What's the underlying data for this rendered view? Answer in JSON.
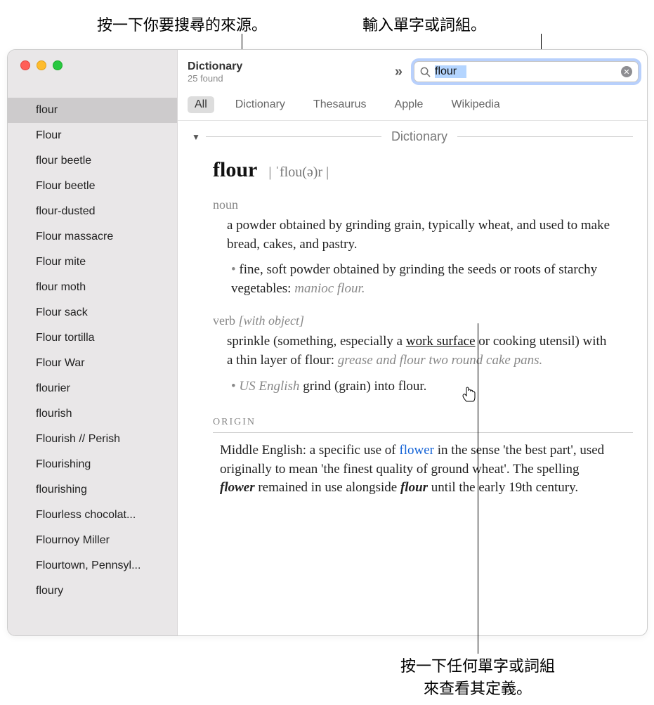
{
  "callouts": {
    "top_left": "按一下你要搜尋的來源。",
    "top_right": "輸入單字或詞組。",
    "bottom_line1": "按一下任何單字或詞組",
    "bottom_line2": "來查看其定義。"
  },
  "window": {
    "title": "Dictionary",
    "subtitle": "25 found"
  },
  "search": {
    "value": "flour"
  },
  "source_tabs": [
    "All",
    "Dictionary",
    "Thesaurus",
    "Apple",
    "Wikipedia"
  ],
  "active_source": "All",
  "sidebar": {
    "selected_index": 0,
    "items": [
      "flour",
      "Flour",
      "flour beetle",
      "Flour beetle",
      "flour-dusted",
      "Flour massacre",
      "Flour mite",
      "flour moth",
      "Flour sack",
      "Flour tortilla",
      "Flour War",
      "flourier",
      "flourish",
      "Flourish // Perish",
      "Flourishing",
      "flourishing",
      "Flourless chocolat...",
      "Flournoy Miller",
      "Flourtown, Pennsyl...",
      "floury"
    ]
  },
  "entry": {
    "section_label": "Dictionary",
    "headword": "flour",
    "pronunciation": "| ˈflou(ə)r |",
    "noun_label": "noun",
    "noun_def": "a powder obtained by grinding grain, typically wheat, and used to make bread, cakes, and pastry.",
    "noun_sub_def_pre": "fine, soft powder obtained by grinding the seeds or roots of starchy vegetables: ",
    "noun_sub_example": "manioc flour.",
    "verb_label": "verb",
    "verb_gram": "[with object]",
    "verb_def_pre": "sprinkle (something, especially a ",
    "verb_def_link": "work surface",
    "verb_def_post": " or cooking utensil) with a thin layer of flour: ",
    "verb_example": "grease and flour two round cake pans.",
    "verb_sub_region": "US English",
    "verb_sub_def": " grind (grain) into flour.",
    "origin_label": "ORIGIN",
    "origin_pre": "Middle English: a specific use of ",
    "origin_link": "flower",
    "origin_mid1": " in the sense 'the best part', used originally to mean 'the finest quality of ground wheat'. The spelling ",
    "origin_em1": "flower",
    "origin_mid2": " remained in use alongside ",
    "origin_em2": "flour",
    "origin_end": " until the early 19th century."
  }
}
